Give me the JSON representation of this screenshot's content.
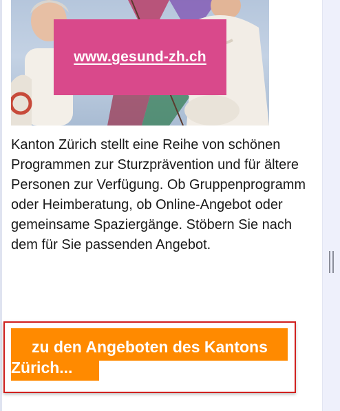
{
  "banner": {
    "url_text": "www.gesund-zh.ch"
  },
  "description": "Kanton Zürich stellt eine Reihe von schönen Programmen zur Sturzprävention und für ältere Personen zur Verfügung. Ob Gruppenprogramm oder Heimberatung, ob Online-Angebot oder gemeinsame Spaziergänge. Stöbern Sie nach dem für Sie passenden Angebot.",
  "cta": {
    "label": "zu den Angeboten des Kantons Zürich..."
  },
  "colors": {
    "banner_pink": "#d9498b",
    "cta_orange": "#ff8a00",
    "highlight_red": "#d0201e"
  }
}
